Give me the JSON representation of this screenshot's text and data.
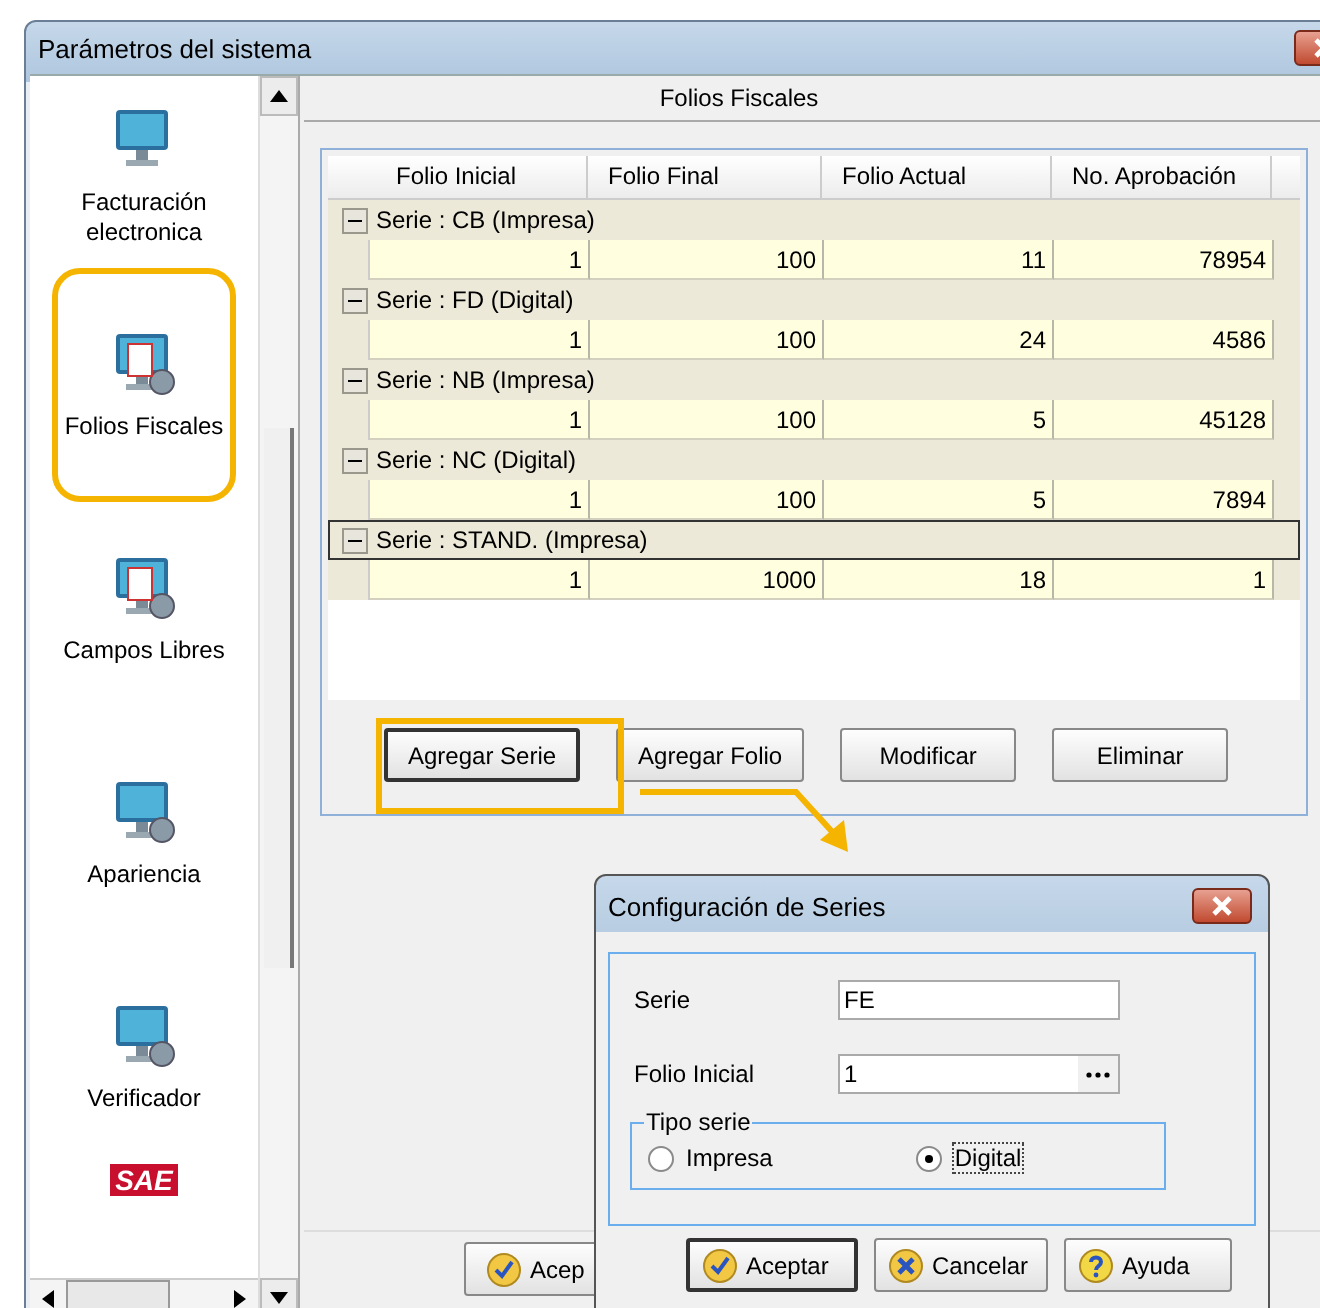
{
  "window": {
    "title": "Parámetros del sistema"
  },
  "sidebar": {
    "items": [
      {
        "label": "Facturación electronica",
        "selected": false
      },
      {
        "label": "Folios Fiscales",
        "selected": true
      },
      {
        "label": "Campos Libres",
        "selected": false
      },
      {
        "label": "Apariencia",
        "selected": false
      },
      {
        "label": "Verificador",
        "selected": false
      }
    ],
    "logo": "SAE"
  },
  "panel": {
    "title": "Folios Fiscales"
  },
  "table": {
    "columns": [
      "Folio Inicial",
      "Folio Final",
      "Folio Actual",
      "No. Aprobación"
    ],
    "groups": [
      {
        "label": "Serie : CB (Impresa)",
        "expanded": true,
        "focused": false,
        "rows": [
          [
            "1",
            "100",
            "11",
            "78954"
          ]
        ]
      },
      {
        "label": "Serie : FD (Digital)",
        "expanded": true,
        "focused": false,
        "rows": [
          [
            "1",
            "100",
            "24",
            "4586"
          ]
        ]
      },
      {
        "label": "Serie : NB (Impresa)",
        "expanded": true,
        "focused": false,
        "rows": [
          [
            "1",
            "100",
            "5",
            "45128"
          ]
        ]
      },
      {
        "label": "Serie : NC (Digital)",
        "expanded": true,
        "focused": false,
        "rows": [
          [
            "1",
            "100",
            "5",
            "7894"
          ]
        ]
      },
      {
        "label": "Serie : STAND. (Impresa)",
        "expanded": true,
        "focused": true,
        "rows": [
          [
            "1",
            "1000",
            "18",
            "1"
          ]
        ]
      }
    ]
  },
  "buttons": [
    {
      "label": "Agregar Serie",
      "highlighted": true
    },
    {
      "label": "Agregar Folio",
      "highlighted": false
    },
    {
      "label": "Modificar",
      "highlighted": false
    },
    {
      "label": "Eliminar",
      "highlighted": false
    }
  ],
  "footer_button": "Acep",
  "dialog": {
    "title": "Configuración de Series",
    "fields": [
      {
        "label": "Serie",
        "value": "FE",
        "kind": "text"
      },
      {
        "label": "Folio Inicial",
        "value": "1",
        "kind": "picker"
      }
    ],
    "group": {
      "title": "Tipo serie",
      "options": [
        {
          "label": "Impresa",
          "selected": false
        },
        {
          "label": "Digital",
          "selected": true
        }
      ]
    },
    "buttons": [
      {
        "label": "Aceptar",
        "kind": "ok"
      },
      {
        "label": "Cancelar",
        "kind": "cancel"
      },
      {
        "label": "Ayuda",
        "kind": "help"
      }
    ]
  }
}
